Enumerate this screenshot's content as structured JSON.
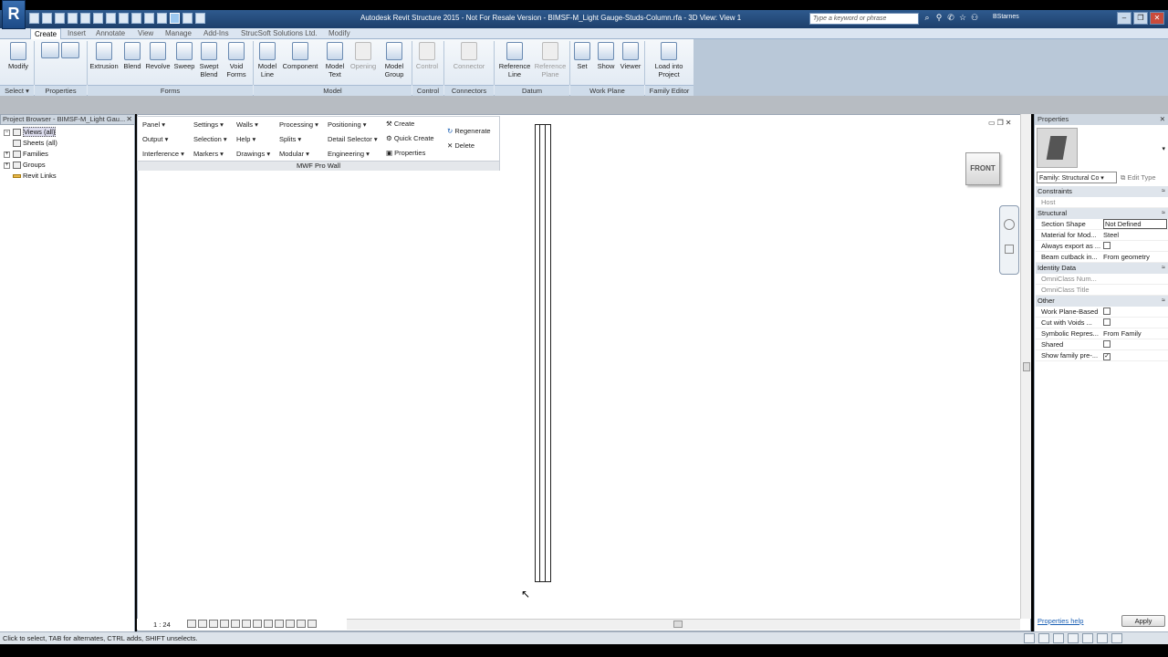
{
  "app": {
    "logo": "R",
    "title": "Autodesk Revit Structure 2015 - Not For Resale Version -   BIMSF-M_Light Gauge-Studs-Column.rfa - 3D View: View 1",
    "search_placeholder": "Type a keyword or phrase",
    "user": "BStarnes",
    "window_controls": [
      "–",
      "❐",
      "✕"
    ]
  },
  "ribbon_tabs": [
    "Create",
    "Insert",
    "Annotate",
    "View",
    "Manage",
    "Add-Ins",
    "StrucSoft Solutions Ltd.",
    "Modify"
  ],
  "ribbon": {
    "modify": "Modify",
    "extrusion": "Extrusion",
    "blend": "Blend",
    "revolve": "Revolve",
    "sweep": "Sweep",
    "swept_blend": "Swept Blend",
    "void_forms": "Void Forms",
    "model_line": "Model Line",
    "component": "Component",
    "model_text": "Model Text",
    "opening": "Opening",
    "model_group": "Model Group",
    "control": "Control",
    "connector": "Connector",
    "reference_line": "Reference Line",
    "reference_plane": "Reference Plane",
    "set": "Set",
    "show": "Show",
    "viewer": "Viewer",
    "load_into_project": "Load into Project",
    "panels": {
      "select": "Select ▾",
      "properties": "Properties",
      "forms": "Forms",
      "model": "Model",
      "control": "Control",
      "connectors": "Connectors",
      "datum": "Datum",
      "work_plane": "Work Plane",
      "family_editor": "Family Editor"
    }
  },
  "project_browser": {
    "title": "Project Browser - BIMSF-M_Light Gau...",
    "items": [
      "Views (all)",
      "Sheets (all)",
      "Families",
      "Groups",
      "Revit Links"
    ]
  },
  "mwf": {
    "menus": [
      "Panel ▾",
      "Settings ▾",
      "Walls ▾",
      "Processing ▾",
      "Positioning ▾",
      "Output ▾",
      "Selection ▾",
      "Help ▾",
      "Splits ▾",
      "Detail Selector ▾",
      "Interference ▾",
      "Markers ▾",
      "Drawings ▾",
      "Modular ▾",
      "Engineering ▾"
    ],
    "create": "Create",
    "quick_create": "Quick Create",
    "properties": "Properties",
    "regenerate": "Regenerate",
    "delete": "Delete",
    "footer": "MWF Pro Wall"
  },
  "viewport": {
    "view_cube": "FRONT",
    "scale": "1 : 24"
  },
  "properties": {
    "title": "Properties",
    "type_selector": "Family: Structural Co",
    "edit_type": "Edit Type",
    "groups": {
      "constraints": "Constraints",
      "structural": "Structural",
      "identity": "Identity Data",
      "other": "Other"
    },
    "rows": {
      "host": [
        "Host",
        ""
      ],
      "section_shape": [
        "Section Shape",
        "Not Defined"
      ],
      "material": [
        "Material for Mod...",
        "Steel"
      ],
      "always_export": [
        "Always export as ...",
        ""
      ],
      "beam_cutback": [
        "Beam cutback in...",
        "From geometry"
      ],
      "omniclass_num": [
        "OmniClass Num...",
        ""
      ],
      "omniclass_title": [
        "OmniClass Title",
        ""
      ],
      "work_plane": [
        "Work Plane-Based",
        ""
      ],
      "cut_voids": [
        "Cut with Voids ...",
        ""
      ],
      "symbolic": [
        "Symbolic Repres...",
        "From Family"
      ],
      "shared": [
        "Shared",
        ""
      ],
      "show_family": [
        "Show family pre-...",
        "✓"
      ]
    },
    "help_link": "Properties help",
    "apply": "Apply"
  },
  "status": {
    "text": "Click to select, TAB for alternates, CTRL adds, SHIFT unselects."
  },
  "colors": {
    "title_bar": "#2e5a8e",
    "ribbon": "#dfe8f2",
    "canvas": "#ffffff"
  }
}
